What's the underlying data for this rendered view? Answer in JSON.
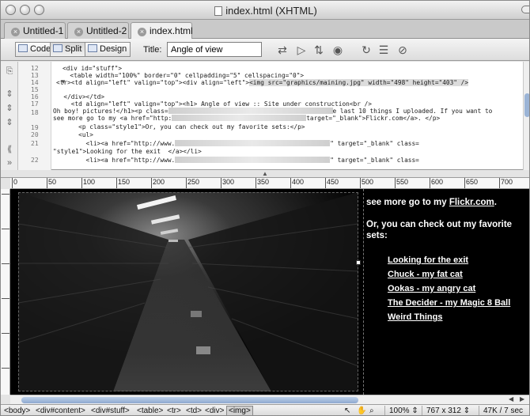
{
  "window": {
    "title": "index.html (XHTML)"
  },
  "tabs": [
    {
      "label": "Untitled-1"
    },
    {
      "label": "Untitled-2"
    },
    {
      "label": "index.html"
    }
  ],
  "toolbar": {
    "code_label": "Code",
    "split_label": "Split",
    "design_label": "Design",
    "title_label": "Title:",
    "title_value": "Angle of view"
  },
  "code": {
    "line_numbers": [
      "12",
      "13",
      "14",
      "15",
      "16",
      "17",
      "18",
      "",
      "19",
      "20",
      "21",
      "",
      "22"
    ],
    "lines": [
      "<div id=\"stuff\">",
      "  <table width=\"100%\" border=\"0\" cellpadding=\"5\" cellspacing=\"0\">",
      "<tr><td align=\"left\" valign=\"top\"><div align=\"left\">",
      "",
      "  </div></td>",
      "    <td align=\"left\" valign=\"top\"><h1> Angle of view :: Site under construction<br />",
      "Oh boy! pictures!</h1><p class=",
      "see more go to my <a href=\"http:",
      "      <p class=\"style1\">Or, you can check out my favorite sets:</p>",
      "      <ul>",
      "        <li><a href=\"http://www.",
      "\"style1\">Looking for the exit  </a></li>",
      "        <li><a href=\"http://www."
    ],
    "img_tag": "<img src=\"graphics/maining.jpg\" width=\"498\" height=\"403\" />",
    "line18_tail": "e last 10 things I uploaded. If you want to",
    "line18b_tail": "target=\"_blank\">Flickr.com</a>. </p>",
    "line21_tail": "\" target=\"_blank\" class=",
    "line22_tail": "\" target=\"_blank\" class="
  },
  "ruler": {
    "marks": [
      "0",
      "50",
      "100",
      "150",
      "200",
      "250",
      "300",
      "350",
      "400",
      "450",
      "500",
      "550",
      "600",
      "650",
      "700"
    ]
  },
  "design": {
    "text_intro": "see more go to my",
    "flickr_link": "Flickr.com",
    "text_period": ".",
    "favorites_text": "Or, you can check out my favorite sets:",
    "links": [
      "Looking for the exit",
      "Chuck - my fat cat",
      "Ookas - my angry cat",
      "The Decider - my Magic 8 Ball",
      "Weird Things"
    ]
  },
  "status": {
    "tags": [
      "<body>",
      "<div#content>",
      "<div#stuff>",
      "<table>",
      "<tr>",
      "<td>",
      "<div>",
      "<img>"
    ],
    "zoom": "100%",
    "dimensions": "767 x 312",
    "size": "47K / 7 sec"
  }
}
